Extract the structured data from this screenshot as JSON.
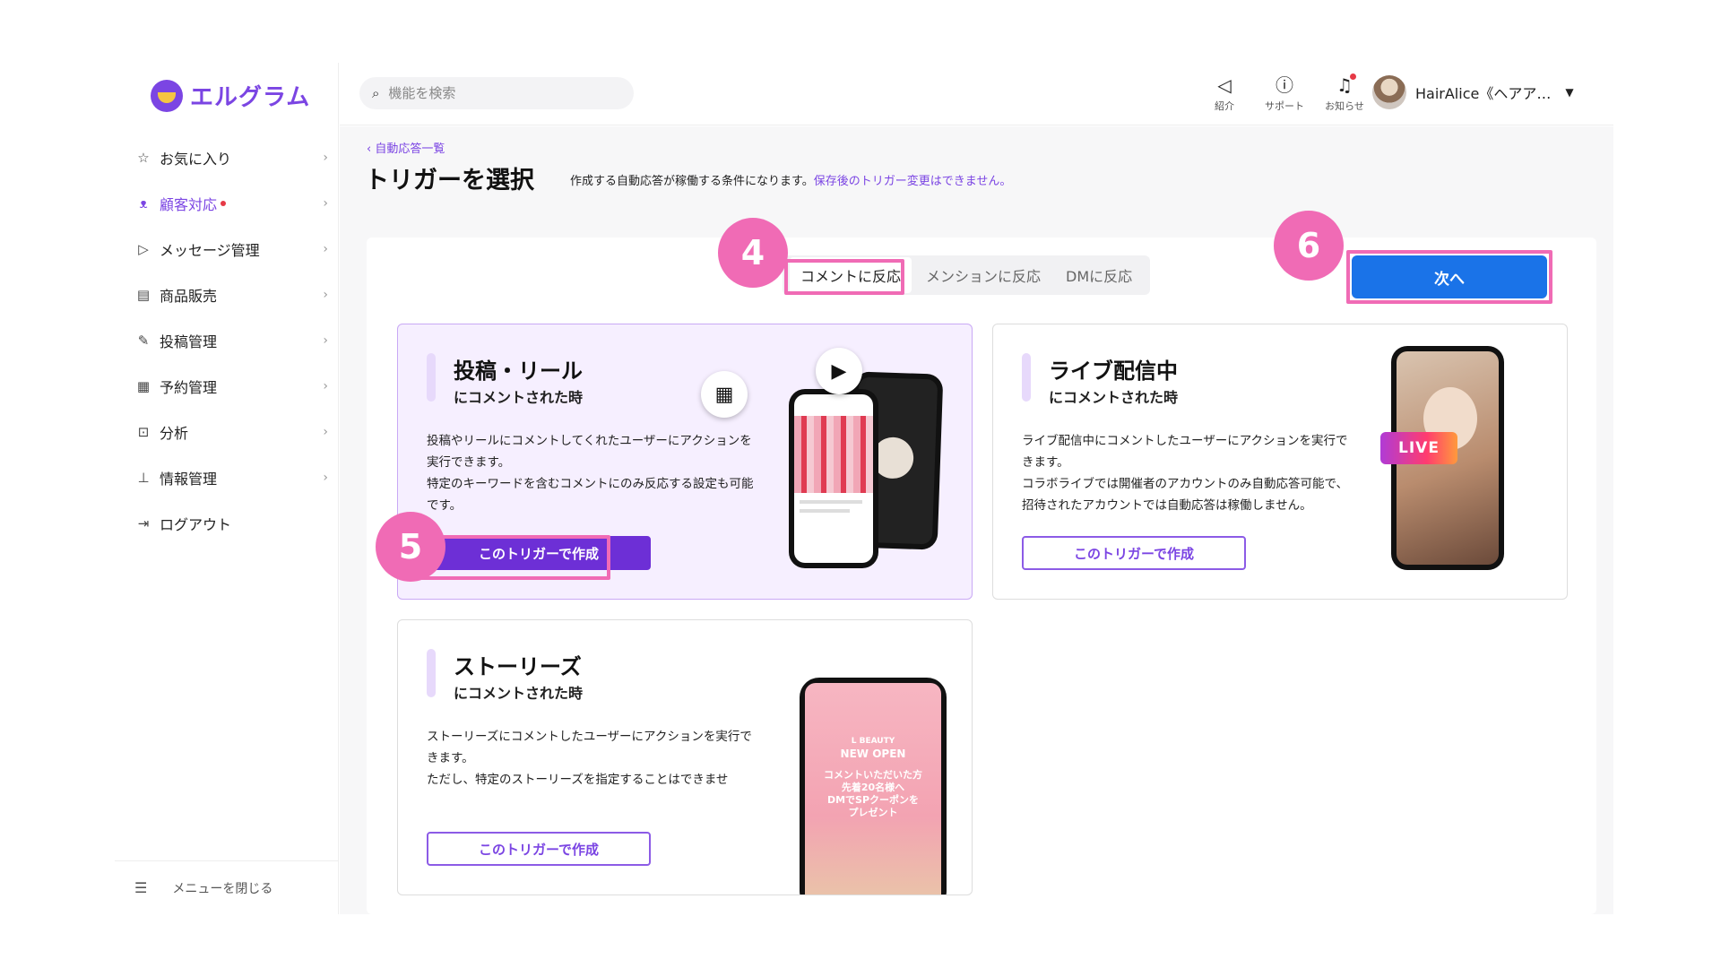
{
  "app": {
    "logo_text": "エルグラム"
  },
  "sidebar": {
    "items": [
      {
        "label": "お気に入り",
        "icon": "star-icon"
      },
      {
        "label": "顧客対応",
        "icon": "user-icon"
      },
      {
        "label": "メッセージ管理",
        "icon": "send-icon"
      },
      {
        "label": "商品販売",
        "icon": "store-icon"
      },
      {
        "label": "投稿管理",
        "icon": "edit-icon"
      },
      {
        "label": "予約管理",
        "icon": "calendar-icon"
      },
      {
        "label": "分析",
        "icon": "analytics-icon"
      },
      {
        "label": "情報管理",
        "icon": "chart-icon"
      },
      {
        "label": "ログアウト",
        "icon": "logout-icon"
      }
    ],
    "close_label": "メニューを閉じる"
  },
  "header": {
    "search_placeholder": "機能を検索",
    "intro_label": "紹介",
    "support_label": "サポート",
    "notify_label": "お知らせ",
    "user_name": "HairAlice《ヘアア…"
  },
  "page": {
    "breadcrumb": "自動応答一覧",
    "title": "トリガーを選択",
    "description": "作成する自動応答が稼働する条件になります。",
    "warning": "保存後のトリガー変更はできません。",
    "tabs": [
      "コメントに反応",
      "メンションに反応",
      "DMに反応"
    ],
    "next_label": "次へ"
  },
  "badges": {
    "b4": "4",
    "b5": "5",
    "b6": "6"
  },
  "cards": [
    {
      "title": "投稿・リール",
      "subtitle": "にコメントされた時",
      "desc1": "投稿やリールにコメントしてくれたユーザーにアクションを実行できます。",
      "desc2": "特定のキーワードを含むコメントにのみ反応する設定も可能です。",
      "button": "このトリガーで作成"
    },
    {
      "title": "ライブ配信中",
      "subtitle": "にコメントされた時",
      "desc1": "ライブ配信中にコメントしたユーザーにアクションを実行できます。",
      "desc2": "コラボライブでは開催者のアカウントのみ自動応答可能で、招待されたアカウントでは自動応答は稼働しません。",
      "button": "このトリガーで作成",
      "live_label": "LIVE"
    },
    {
      "title": "ストーリーズ",
      "subtitle": "にコメントされた時",
      "desc1": "ストーリーズにコメントしたユーザーにアクションを実行できます。",
      "desc2": "ただし、特定のストーリーズを指定することはできませ",
      "button": "このトリガーで作成",
      "story_brand": "L BEAUTY",
      "story_headline": "NEW OPEN",
      "story_lines": [
        "コメントいただいた方",
        "先着20名様へ",
        "DMでSPクーポンを",
        "プレゼント"
      ]
    }
  ],
  "colors": {
    "accent": "#7b45e3",
    "primary": "#1a73e8",
    "highlight": "#f06bb5"
  }
}
